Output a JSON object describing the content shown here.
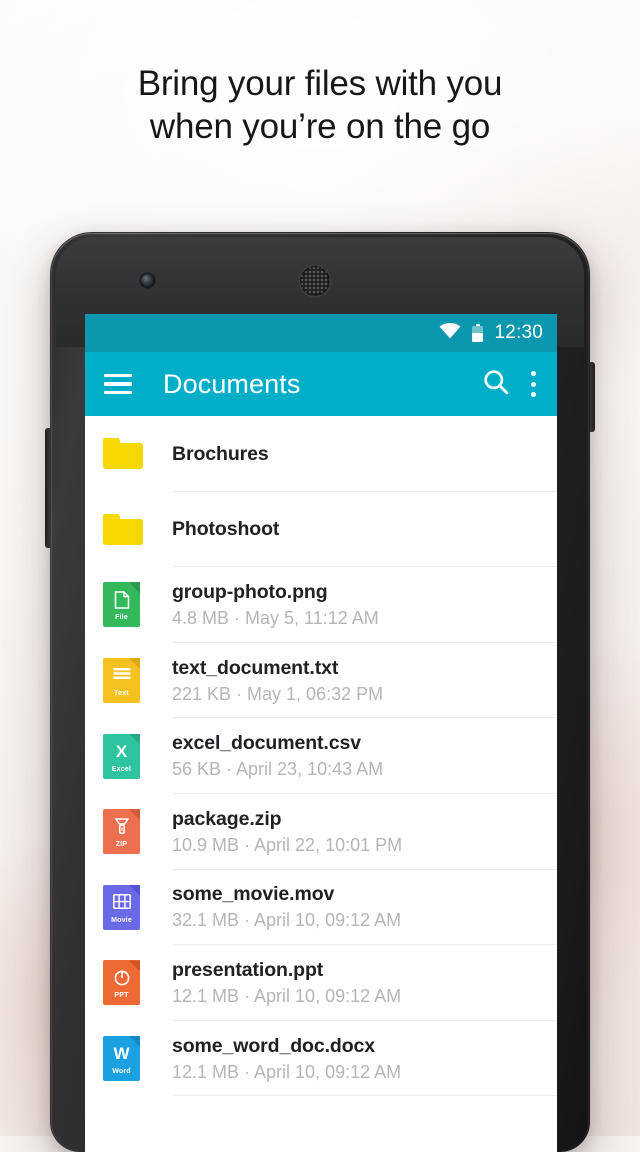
{
  "headline": {
    "line1": "Bring your files with you",
    "line2": "when you’re on the go"
  },
  "colors": {
    "statusbar": "#0b97ad",
    "appbar": "#00aec7",
    "folder": "#f5d800",
    "title_text": "#202124",
    "subtitle_text": "#b3b6b8",
    "divider": "#eceded"
  },
  "statusbar": {
    "time": "12:30",
    "wifi_icon": "wifi-icon",
    "battery_icon": "battery-icon"
  },
  "appbar": {
    "menu_icon": "hamburger-menu-icon",
    "title": "Documents",
    "search_icon": "search-icon",
    "overflow_icon": "overflow-menu-icon"
  },
  "files": [
    {
      "name": "Brochures",
      "meta": "",
      "kind": "folder",
      "icon": "folder-icon",
      "icon_label": "",
      "icon_color": "#f5d800",
      "icon_color_dark": "#d8bf00"
    },
    {
      "name": "Photoshoot",
      "meta": "",
      "kind": "folder",
      "icon": "folder-icon",
      "icon_label": "",
      "icon_color": "#f5d800",
      "icon_color_dark": "#d8bf00"
    },
    {
      "name": "group-photo.png",
      "meta": "4.8 MB · May 5, 11:12 AM",
      "kind": "file",
      "icon": "file-generic-icon",
      "icon_label": "File",
      "icon_color": "#34b85c",
      "icon_color_dark": "#2a9a4c"
    },
    {
      "name": "text_document.txt",
      "meta": "221 KB · May 1, 06:32 PM",
      "kind": "file",
      "icon": "file-text-icon",
      "icon_label": "Text",
      "icon_color": "#f4c11f",
      "icon_color_dark": "#dba80f"
    },
    {
      "name": "excel_document.csv",
      "meta": "56 KB · April 23, 10:43 AM",
      "kind": "file",
      "icon": "file-excel-icon",
      "icon_label": "Excel",
      "icon_color": "#2ec4a0",
      "icon_color_dark": "#23a888",
      "glyph": "X"
    },
    {
      "name": "package.zip",
      "meta": "10.9 MB · April 22, 10:01 PM",
      "kind": "file",
      "icon": "file-zip-icon",
      "icon_label": "ZIP",
      "icon_color": "#ec7050",
      "icon_color_dark": "#d25a3c"
    },
    {
      "name": "some_movie.mov",
      "meta": "32.1 MB · April 10, 09:12 AM",
      "kind": "file",
      "icon": "file-movie-icon",
      "icon_label": "Movie",
      "icon_color": "#6a6ae8",
      "icon_color_dark": "#5252d0"
    },
    {
      "name": "presentation.ppt",
      "meta": "12.1 MB · April 10, 09:12 AM",
      "kind": "file",
      "icon": "file-ppt-icon",
      "icon_label": "PPT",
      "icon_color": "#ee6a35",
      "icon_color_dark": "#d45525"
    },
    {
      "name": "some_word_doc.docx",
      "meta": "12.1 MB · April 10, 09:12 AM",
      "kind": "file",
      "icon": "file-word-icon",
      "icon_label": "Word",
      "icon_color": "#1ba1e2",
      "icon_color_dark": "#0f88c4",
      "glyph": "W"
    }
  ],
  "device": {
    "camera_icon": "front-camera",
    "speaker_icon": "earpiece-speaker",
    "button_right": "power-button",
    "button_left": "volume-rocker"
  }
}
